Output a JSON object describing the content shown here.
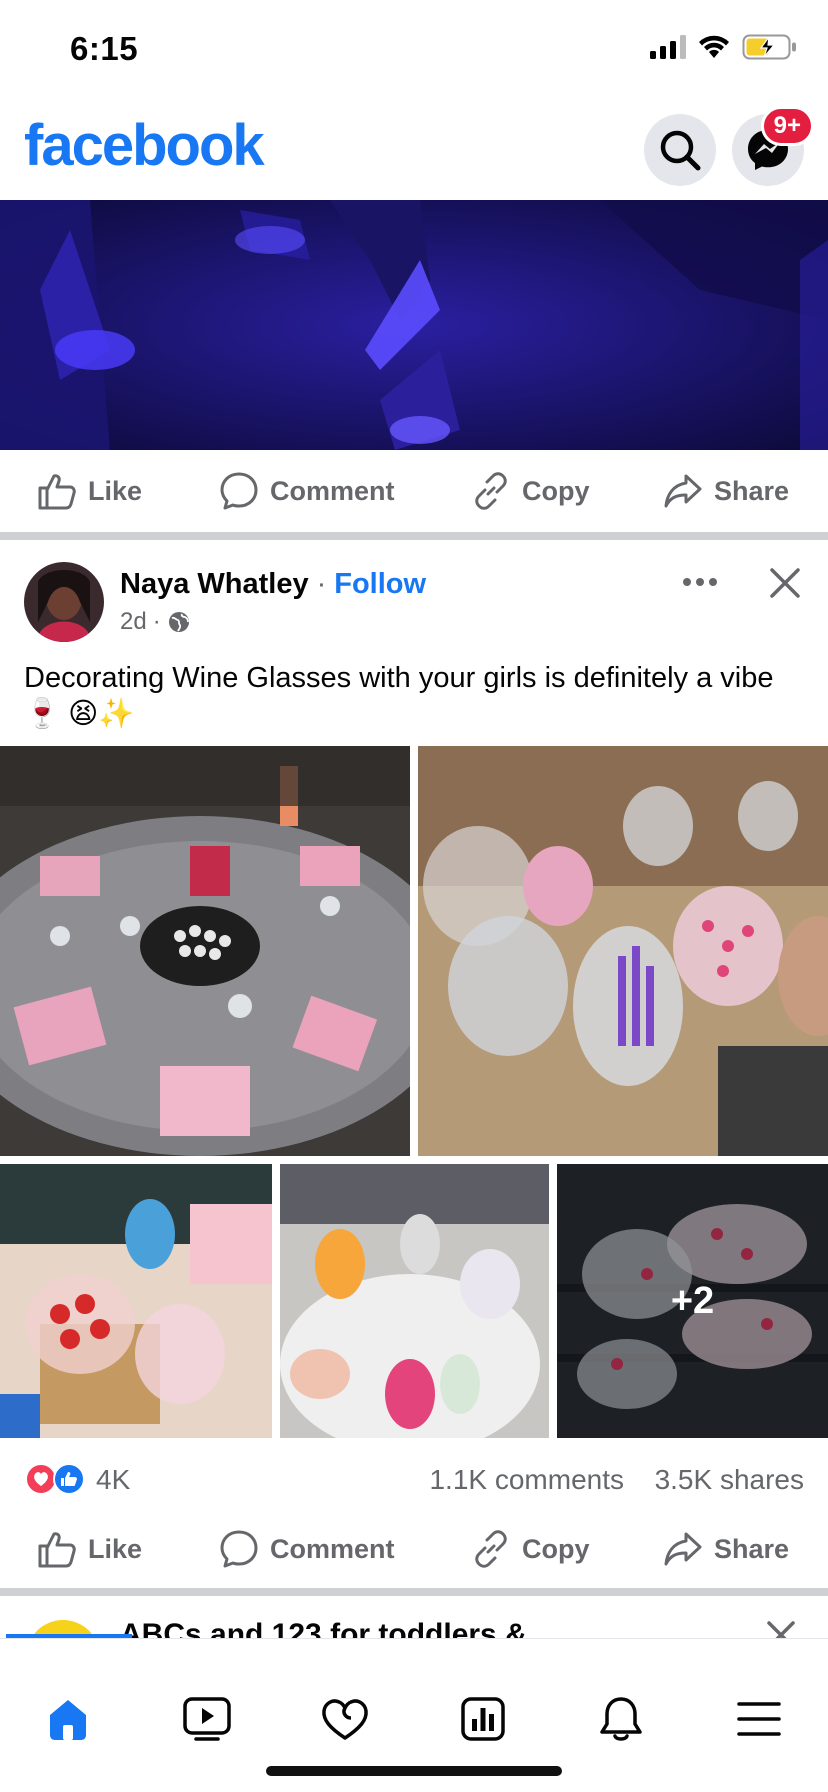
{
  "status_bar": {
    "time": "6:15"
  },
  "header": {
    "logo_text": "facebook",
    "messenger_badge": "9+"
  },
  "actions": {
    "like": "Like",
    "comment": "Comment",
    "copy": "Copy",
    "share": "Share"
  },
  "post": {
    "author": "Naya Whatley",
    "separator": "·",
    "follow_label": "Follow",
    "time": "2d",
    "meta_dot": "·",
    "caption": "Decorating Wine Glasses with your girls is definitely a vibe 🍷 😫✨",
    "more_photos": "+2",
    "reaction_count": "4K",
    "comments_count": "1.1K comments",
    "shares_count": "3.5K shares"
  },
  "next_post": {
    "title": "ABCs and 123 for toddlers &"
  },
  "colors": {
    "brand": "#1877F2",
    "badge": "#E41E3F",
    "secondary_text": "#65676B"
  },
  "icons": {
    "status": [
      "signal-icon",
      "wifi-icon",
      "battery-charging-icon"
    ],
    "header": [
      "search-icon",
      "messenger-icon"
    ],
    "nav": [
      "home-icon",
      "video-icon",
      "dating-heart-icon",
      "dashboard-icon",
      "bell-icon",
      "menu-icon"
    ]
  }
}
